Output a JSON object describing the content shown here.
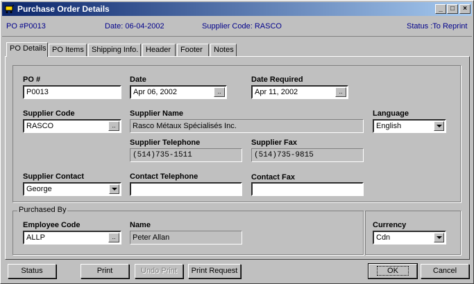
{
  "window": {
    "title": "Purchase Order Details",
    "controls": {
      "minimize": "_",
      "maximize": "□",
      "close": "×"
    }
  },
  "infobar": {
    "po": "PO #P0013",
    "date": "Date: 06-04-2002",
    "supplier": "Supplier Code: RASCO",
    "status": "Status :To Reprint"
  },
  "tabs": [
    {
      "label": "PO Details",
      "active": true
    },
    {
      "label": "PO Items"
    },
    {
      "label": "Shipping Info."
    },
    {
      "label": "Header"
    },
    {
      "label": "Footer"
    },
    {
      "label": "Notes"
    }
  ],
  "form": {
    "po_label": "PO #",
    "po_value": "P0013",
    "date_label": "Date",
    "date_value": "Apr 06, 2002",
    "date_req_label": "Date Required",
    "date_req_value": "Apr 11, 2002",
    "supplier_code_label": "Supplier Code",
    "supplier_code_value": "RASCO",
    "supplier_name_label": "Supplier Name",
    "supplier_name_value": "Rasco Métaux Spécialisés Inc.",
    "language_label": "Language",
    "language_value": "English",
    "supplier_tel_label": "Supplier Telephone",
    "supplier_tel_value": "(514)735-1511",
    "supplier_fax_label": "Supplier Fax",
    "supplier_fax_value": "(514)735-9815",
    "contact_label": "Supplier Contact",
    "contact_value": "George",
    "contact_tel_label": "Contact Telephone",
    "contact_tel_value": "",
    "contact_fax_label": "Contact Fax",
    "contact_fax_value": "",
    "ellipsis": ".."
  },
  "purchased_by": {
    "group_label": "Purchased By",
    "employee_code_label": "Employee Code",
    "employee_code_value": "ALLP",
    "name_label": "Name",
    "name_value": "Peter Allan",
    "currency_label": "Currency",
    "currency_value": "Cdn"
  },
  "buttons": {
    "status": "Status",
    "print": "Print",
    "undo_print": "Undo Print",
    "print_request": "Print Request",
    "ok": "OK",
    "cancel": "Cancel"
  }
}
